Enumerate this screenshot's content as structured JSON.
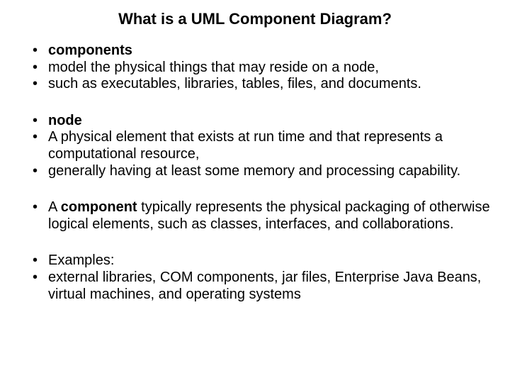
{
  "title": "What is a UML Component Diagram?",
  "group1": {
    "item1": "components",
    "item2": "model the physical things that may reside on a node,",
    "item3": "such as executables, libraries, tables, files, and documents."
  },
  "group2": {
    "item1": "node",
    "item2": "A physical element that exists at run time and that represents a computational resource,",
    "item3": "generally having at least some memory and  processing capability."
  },
  "group3": {
    "item1_pre": " A ",
    "item1_bold": "component",
    "item1_post": " typically represents the physical packaging of otherwise logical elements, such as classes, interfaces, and collaborations."
  },
  "group4": {
    "item1": "Examples:",
    "item2": " external libraries, COM components, jar files, Enterprise Java Beans, virtual machines, and operating systems"
  }
}
